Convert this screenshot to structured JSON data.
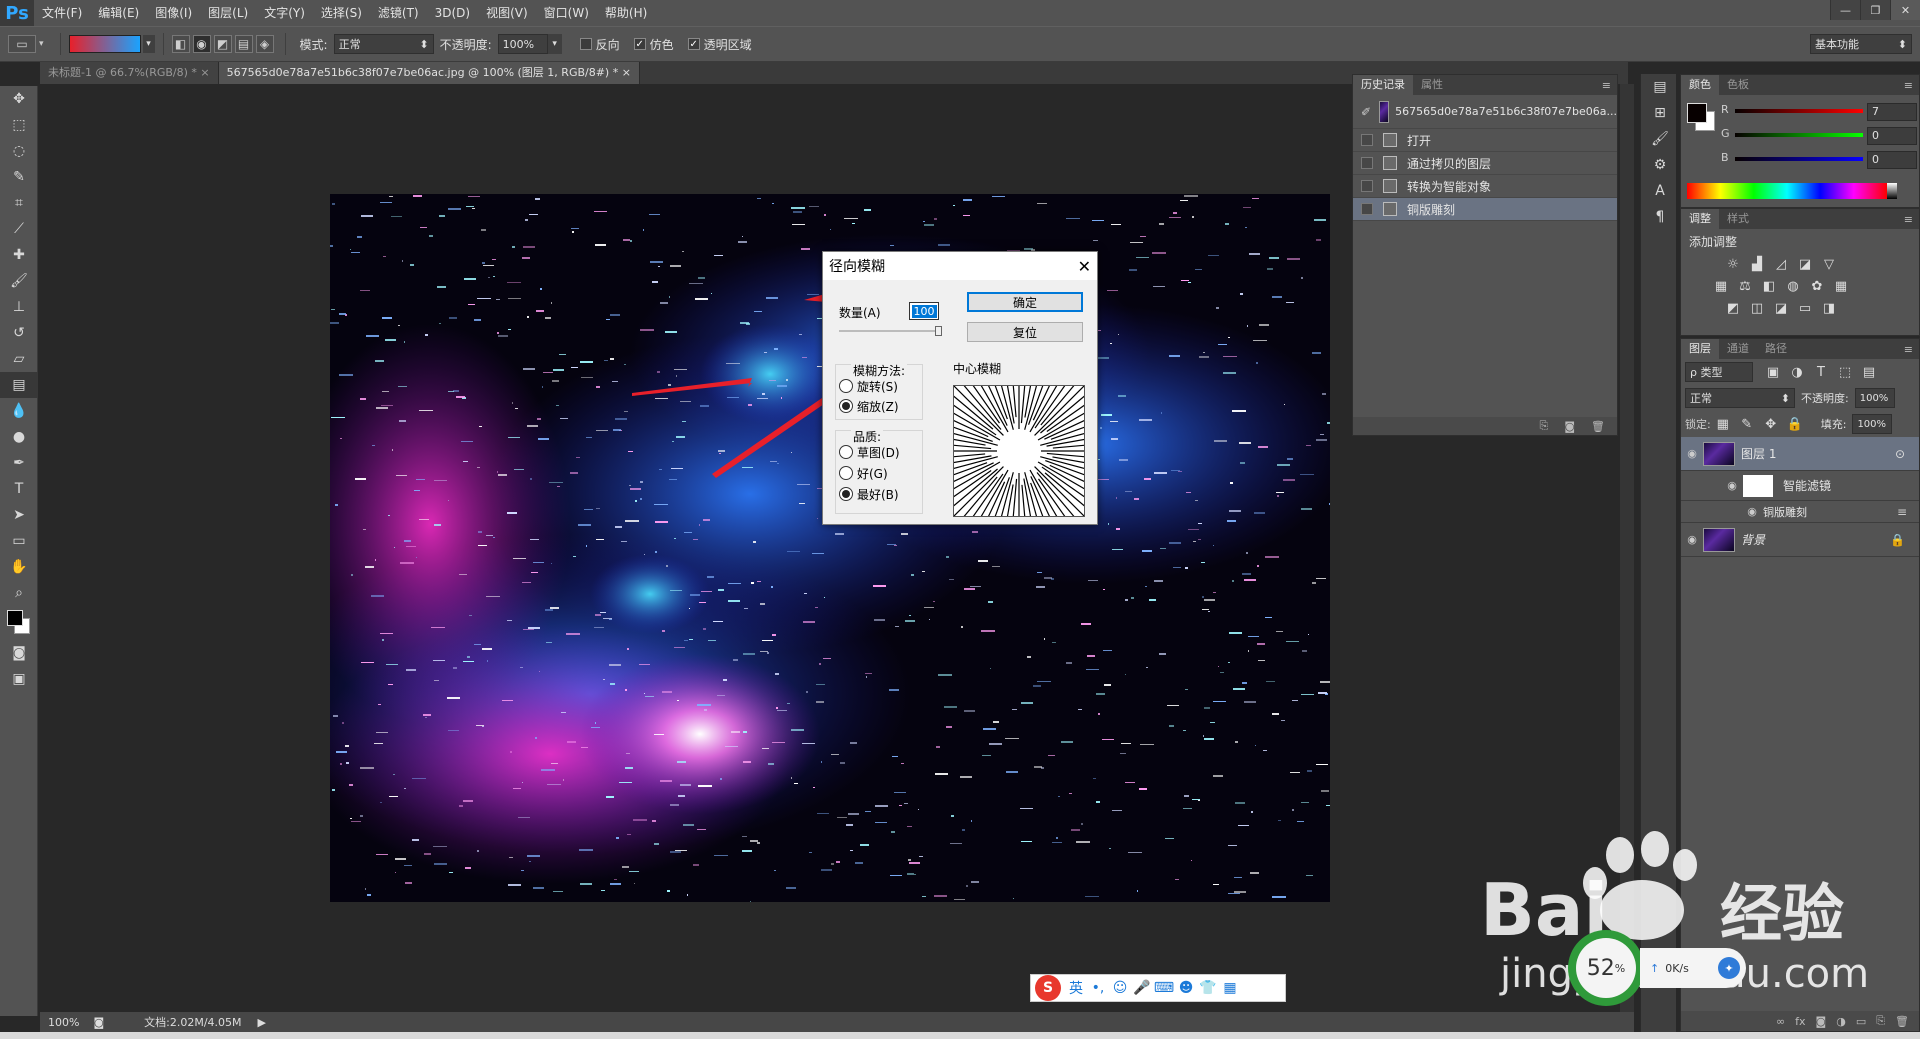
{
  "app": {
    "logo": "Ps"
  },
  "menu": [
    "文件(F)",
    "编辑(E)",
    "图像(I)",
    "图层(L)",
    "文字(Y)",
    "选择(S)",
    "滤镜(T)",
    "3D(D)",
    "视图(V)",
    "窗口(W)",
    "帮助(H)"
  ],
  "options": {
    "mode_label": "模式:",
    "mode_value": "正常",
    "opacity_label": "不透明度:",
    "opacity_value": "100%",
    "reverse_label": "反向",
    "dither_label": "仿色",
    "transparency_label": "透明区域",
    "workspace": "基本功能",
    "gradient_colors": [
      "#e8202a",
      "#1aa3ff"
    ]
  },
  "tabs": [
    {
      "label": "未标题-1 @ 66.7%(RGB/8) *"
    },
    {
      "label": "567565d0e78a7e51b6c38f07e7be06ac.jpg @ 100% (图层 1, RGB/8#) *"
    }
  ],
  "status": {
    "zoom": "100%",
    "doc": "文档:2.02M/4.05M"
  },
  "dialog": {
    "title": "径向模糊",
    "amount_label": "数量(A)",
    "amount_value": "100",
    "ok_label": "确定",
    "reset_label": "复位",
    "method_label": "模糊方法:",
    "method_spin": "旋转(S)",
    "method_zoom": "缩放(Z)",
    "quality_label": "品质:",
    "quality_draft": "草图(D)",
    "quality_good": "好(G)",
    "quality_best": "最好(B)",
    "center_label": "中心模糊"
  },
  "history": {
    "tabs": [
      "历史记录",
      "属性"
    ],
    "snapshot": "567565d0e78a7e51b6c38f07e7be06a...",
    "items": [
      "打开",
      "通过拷贝的图层",
      "转换为智能对象",
      "铜版雕刻"
    ]
  },
  "color": {
    "tabs": [
      "颜色",
      "色板"
    ],
    "r_label": "R",
    "r_value": "7",
    "g_label": "G",
    "g_value": "0",
    "b_label": "B",
    "b_value": "0"
  },
  "adjust": {
    "tabs": [
      "调整",
      "样式"
    ],
    "title": "添加调整"
  },
  "layers": {
    "tabs": [
      "图层",
      "通道",
      "路径"
    ],
    "kind_value": "ρ 类型",
    "blend_value": "正常",
    "opacity_label": "不透明度:",
    "opacity_value": "100%",
    "lock_label": "锁定:",
    "fill_label": "填充:",
    "fill_value": "100%",
    "items": [
      {
        "name": "图层 1"
      },
      {
        "name": "智能滤镜"
      },
      {
        "name": "铜版雕刻"
      },
      {
        "name": "背景"
      }
    ]
  },
  "ime": {
    "lang": "英"
  },
  "overlay": {
    "percent": "52",
    "percent_unit": "%",
    "net_speed": "0K/s"
  }
}
